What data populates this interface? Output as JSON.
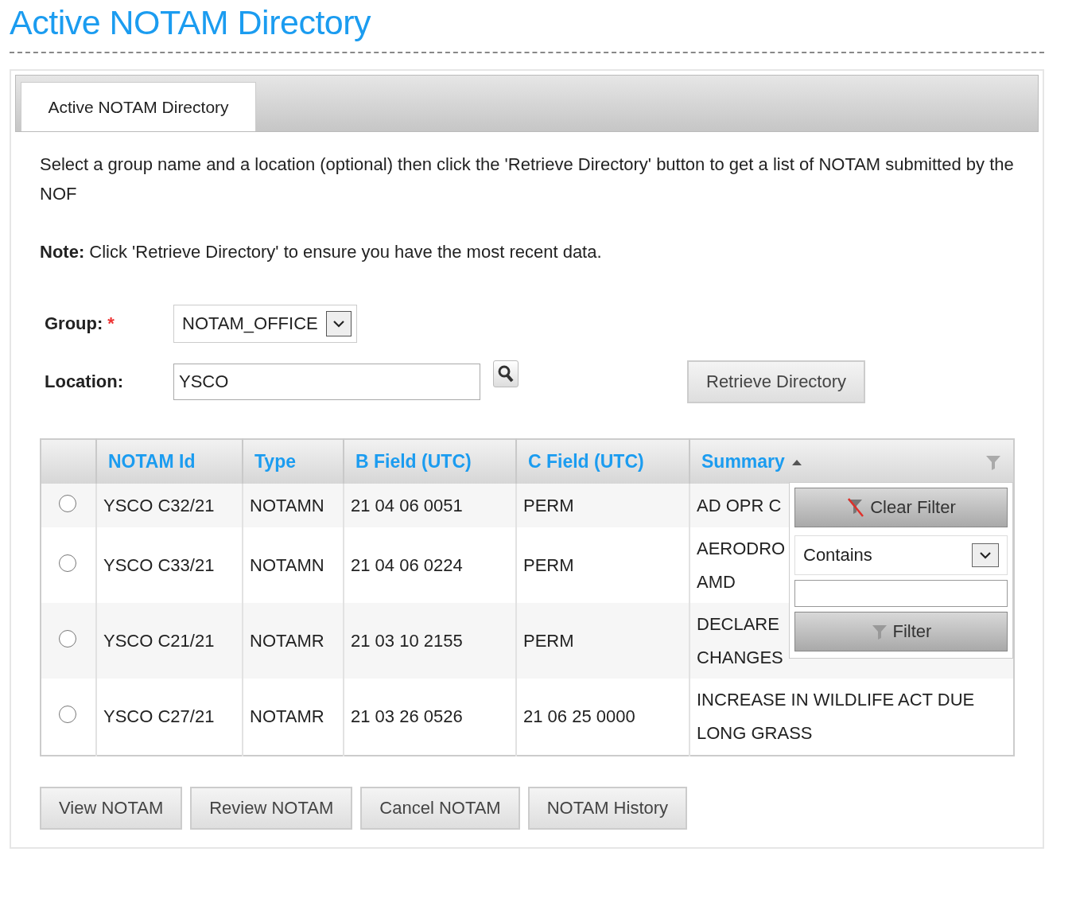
{
  "page_title": "Active NOTAM Directory",
  "tabs": [
    {
      "label": "Active NOTAM Directory",
      "selected": true
    }
  ],
  "instructions": "Select a group name and a location (optional) then click the 'Retrieve Directory' button to get a list of NOTAM submitted by the NOF",
  "note": "**Note:** Click 'Retrieve Directory' to ensure you have the most recent data.",
  "form": {
    "group": {
      "label": "Group:",
      "required_mark": "*",
      "value": "NOTAM_OFFICE"
    },
    "location": {
      "label": "Location:",
      "value": "YSCO"
    },
    "retrieve_button": "Retrieve Directory"
  },
  "table": {
    "columns": [
      {
        "label": "NOTAM Id",
        "sorted": false
      },
      {
        "label": "Type",
        "sorted": false
      },
      {
        "label": "B Field (UTC)",
        "sorted": false
      },
      {
        "label": "C Field (UTC)",
        "sorted": false
      },
      {
        "label": "Summary",
        "sorted": true
      }
    ],
    "rows": [
      {
        "selected": false,
        "cells": [
          "YSCO C32/21",
          "NOTAMN",
          "21 04 06 0051",
          "PERM",
          "AD OPR C"
        ]
      },
      {
        "selected": false,
        "cells": [
          "YSCO C33/21",
          "NOTAMN",
          "21 04 06 0224",
          "PERM",
          "AERODRO\nAMD"
        ]
      },
      {
        "selected": false,
        "cells": [
          "YSCO C21/21",
          "NOTAMR",
          "21 03 10 2155",
          "PERM",
          "DECLARE\nCHANGES"
        ]
      },
      {
        "selected": false,
        "cells": [
          "YSCO C27/21",
          "NOTAMR",
          "21 03 26 0526",
          "21 06 25 0000",
          "INCREASE IN WILDLIFE ACT DUE\nLONG GRASS"
        ]
      }
    ]
  },
  "filter_menu": {
    "clear_button": "Clear Filter",
    "operator": "Contains",
    "filter_button": "Filter"
  },
  "action_buttons": [
    "View NOTAM",
    "Review NOTAM",
    "Cancel NOTAM",
    "NOTAM History"
  ]
}
